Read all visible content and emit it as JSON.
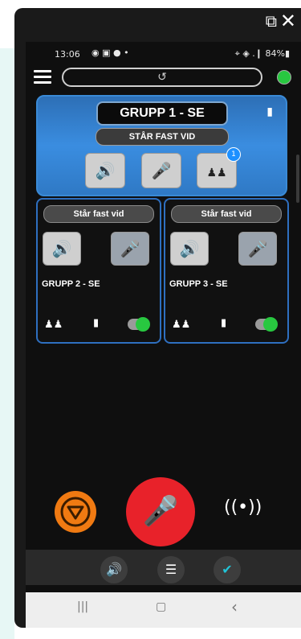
{
  "window": {
    "popout_label": "⧉",
    "close_label": "✕"
  },
  "status_bar": {
    "time": "13:06",
    "icons": "◉ ▣ ● •",
    "right": "⌖ ◈ .❙ 84%▮"
  },
  "top_bar": {
    "history_icon": "↺"
  },
  "group1": {
    "title": "GRUPP 1 - SE",
    "status": "STÅR FAST VID",
    "badge": "1"
  },
  "cards": [
    {
      "status": "Står fast vid",
      "name": "GRUPP 2 - SE"
    },
    {
      "status": "Står fast vid",
      "name": "GRUPP 3 - SE"
    }
  ],
  "icons": {
    "speaker": "🔊",
    "mic": "🎤",
    "group": "♟♟",
    "walkie": "▮",
    "list": "☰",
    "check": "✔",
    "signal": "((•))",
    "nav_menu": "|||",
    "nav_home": "▢",
    "nav_back": "‹"
  },
  "colors": {
    "accent_blue": "#3a8de0",
    "green": "#28c840",
    "red": "#e8222a",
    "orange": "#f07a12"
  }
}
